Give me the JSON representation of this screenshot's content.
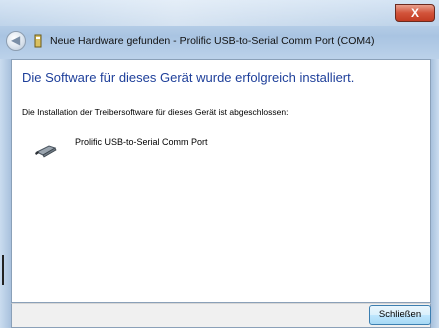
{
  "window": {
    "title": "Neue Hardware gefunden - Prolific USB-to-Serial Comm Port (COM4)",
    "close_label": "X"
  },
  "content": {
    "heading": "Die Software für dieses Gerät wurde erfolgreich installiert.",
    "subtext": "Die Installation der Treibersoftware für dieses Gerät ist abgeschlossen:",
    "device_name": "Prolific USB-to-Serial Comm Port",
    "device_icon": "serial-port-icon"
  },
  "footer": {
    "close_button_label": "Schließen"
  },
  "colors": {
    "heading": "#1e3f9a",
    "close_button": "#c23b22"
  }
}
